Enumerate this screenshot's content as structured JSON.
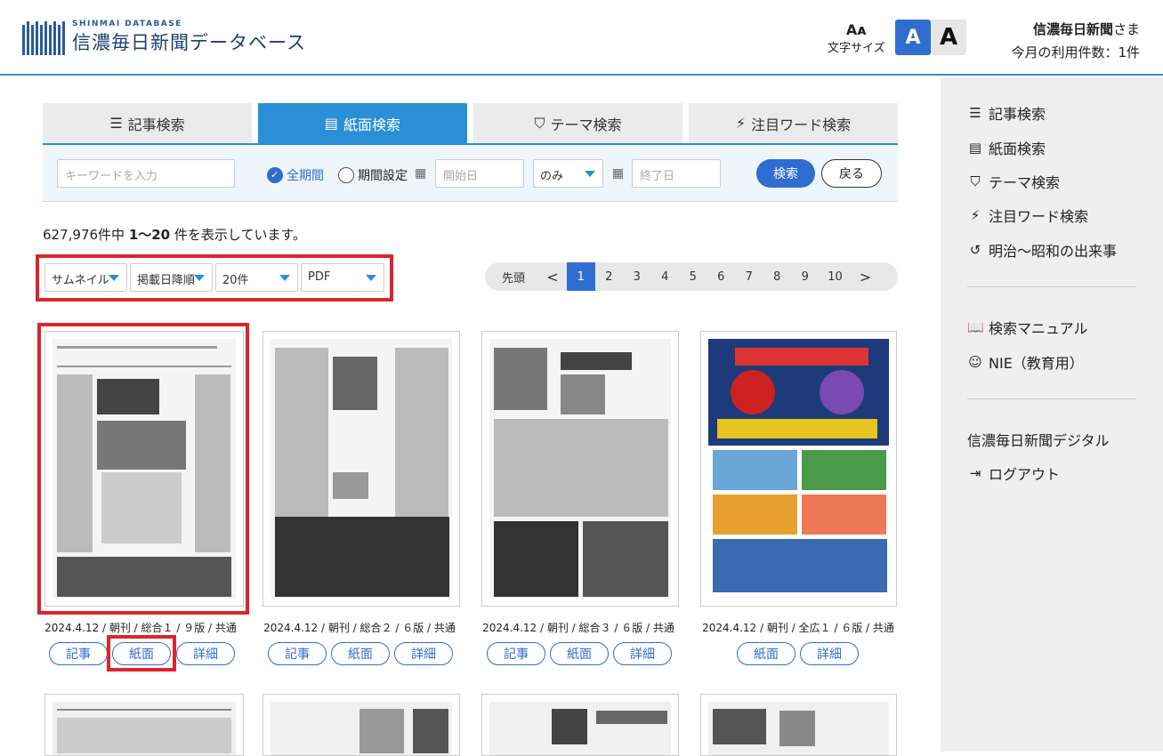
{
  "header": {
    "logo_sub": "SHINMAI DATABASE",
    "logo_title": "信濃毎日新聞データベース",
    "font_size_label": "文字サイズ",
    "font_small": "A",
    "font_large": "A",
    "user_name": "信濃毎日新聞",
    "user_suffix": "さま",
    "usage": "今月の利用件数：1件"
  },
  "tabs": [
    {
      "label": "記事検索",
      "icon": "list-icon"
    },
    {
      "label": "紙面検索",
      "icon": "newspaper-icon",
      "active": true
    },
    {
      "label": "テーマ検索",
      "icon": "bookmark-icon"
    },
    {
      "label": "注目ワード検索",
      "icon": "bolt-icon"
    }
  ],
  "search": {
    "keyword_placeholder": "キーワードを入力",
    "all_period": "全期間",
    "set_period": "期間設定",
    "start_placeholder": "開始日",
    "mode": "のみ",
    "end_placeholder": "終了日",
    "search_button": "検索",
    "back_button": "戻る"
  },
  "result": {
    "total": "627,976件中",
    "range": "1〜20",
    "suffix": "件を表示しています。"
  },
  "filters": {
    "view": "サムネイル",
    "sort": "掲載日降順",
    "count": "20件",
    "format": "PDF"
  },
  "pagination": {
    "first": "先頭",
    "prev": "<",
    "pages": [
      "1",
      "2",
      "3",
      "4",
      "5",
      "6",
      "7",
      "8",
      "9",
      "10"
    ],
    "current": "1",
    "next": ">"
  },
  "cards": [
    {
      "caption": "2024.4.12 / 朝刊 / 総合１ / ９版 / 共通",
      "buttons": [
        "記事",
        "紙面",
        "詳細"
      ]
    },
    {
      "caption": "2024.4.12 / 朝刊 / 総合２ / ６版 / 共通",
      "buttons": [
        "記事",
        "紙面",
        "詳細"
      ]
    },
    {
      "caption": "2024.4.12 / 朝刊 / 総合３ / ６版 / 共通",
      "buttons": [
        "記事",
        "紙面",
        "詳細"
      ]
    },
    {
      "caption": "2024.4.12 / 朝刊 / 全広１ / ６版 / 共通",
      "buttons": [
        "紙面",
        "詳細"
      ]
    }
  ],
  "sidebar": {
    "items": [
      {
        "label": "記事検索",
        "icon": "list-icon"
      },
      {
        "label": "紙面検索",
        "icon": "newspaper-icon"
      },
      {
        "label": "テーマ検索",
        "icon": "bookmark-icon"
      },
      {
        "label": "注目ワード検索",
        "icon": "bolt-icon"
      },
      {
        "label": "明治〜昭和の出来事",
        "icon": "history-icon"
      },
      {
        "label": "検索マニュアル",
        "icon": "book-icon"
      },
      {
        "label": "NIE（教育用）",
        "icon": "student-icon"
      },
      {
        "label": "信濃毎日新聞デジタル",
        "icon": ""
      },
      {
        "label": "ログアウト",
        "icon": "logout-icon"
      }
    ]
  }
}
